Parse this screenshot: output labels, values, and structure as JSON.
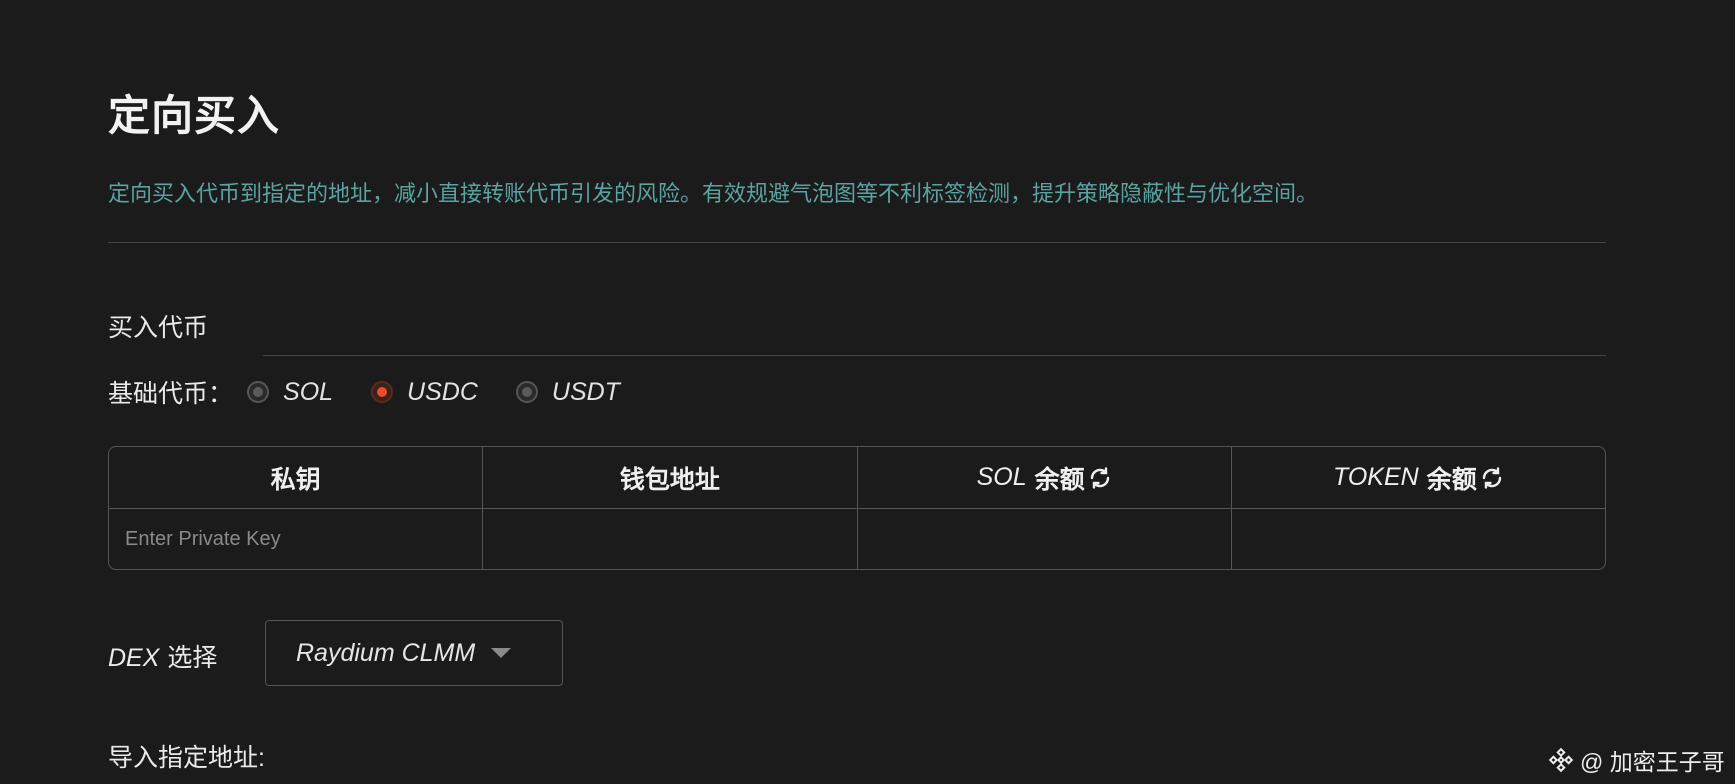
{
  "header": {
    "title": "定向买入",
    "description": "定向买入代币到指定的地址，减小直接转账代币引发的风险。有效规避气泡图等不利标签检测，提升策略隐蔽性与优化空间。"
  },
  "buy_section": {
    "label": "买入代币",
    "base_token_label": "基础代币：",
    "options": [
      "SOL",
      "USDC",
      "USDT"
    ],
    "selected": "USDC"
  },
  "table": {
    "headers": {
      "private_key": "私钥",
      "wallet_address": "钱包地址",
      "sol_prefix": "SOL",
      "sol_suffix": "余额",
      "token_prefix": "TOKEN",
      "token_suffix": "余额"
    },
    "row": {
      "private_key_placeholder": "Enter Private Key",
      "private_key_value": "",
      "wallet_address": "",
      "sol_balance": "",
      "token_balance": ""
    }
  },
  "dex": {
    "label_prefix": "DEX",
    "label_suffix": "选择",
    "selected": "Raydium CLMM"
  },
  "import": {
    "label": "导入指定地址:"
  },
  "watermark": {
    "text": "@ 加密王子哥"
  },
  "colors": {
    "background": "#1b1b1b",
    "description": "#5aa3a0",
    "radio_selected": "#ee4c2c",
    "border": "#555555"
  },
  "icons": {
    "refresh": "refresh-icon",
    "dropdown": "caret-down-icon",
    "watermark_logo": "binance-logo-icon"
  }
}
